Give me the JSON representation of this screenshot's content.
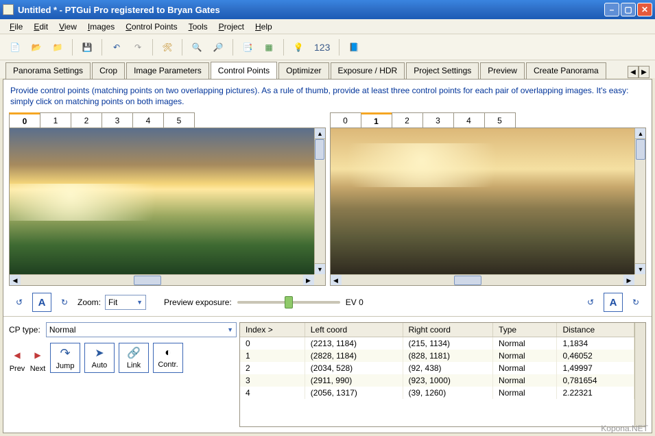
{
  "window": {
    "title": "Untitled * - PTGui Pro registered to Bryan Gates"
  },
  "menu": {
    "file": "File",
    "edit": "Edit",
    "view": "View",
    "images": "Images",
    "cpoints": "Control Points",
    "tools": "Tools",
    "project": "Project",
    "help": "Help"
  },
  "toolbar": {
    "numeric": "123"
  },
  "tabs": {
    "items": [
      "Panorama Settings",
      "Crop",
      "Image Parameters",
      "Control Points",
      "Optimizer",
      "Exposure / HDR",
      "Project Settings",
      "Preview",
      "Create Panorama"
    ],
    "active_index": 3
  },
  "instructions": "Provide control points (matching points on two overlapping pictures). As a rule of thumb, provide at least three control points for each pair of overlapping images. It's easy: simply click on matching points on both images.",
  "image_tabs": {
    "left_active": 0,
    "right_active": 1,
    "labels": [
      "0",
      "1",
      "2",
      "3",
      "4",
      "5"
    ]
  },
  "controls": {
    "zoom_label": "Zoom:",
    "zoom_value": "Fit",
    "preview_exposure_label": "Preview exposure:",
    "ev_label": "EV 0",
    "a_label": "A"
  },
  "cp": {
    "type_label": "CP type:",
    "type_value": "Normal",
    "prev": "Prev",
    "next": "Next",
    "jump": "Jump",
    "auto": "Auto",
    "link": "Link",
    "contr": "Contr."
  },
  "table": {
    "headers": [
      "Index >",
      "Left coord",
      "Right coord",
      "Type",
      "Distance"
    ],
    "rows": [
      {
        "idx": "0",
        "left": "(2213, 1184)",
        "right": "(215, 1134)",
        "type": "Normal",
        "dist": "1,1834"
      },
      {
        "idx": "1",
        "left": "(2828, 1184)",
        "right": "(828, 1181)",
        "type": "Normal",
        "dist": "0,46052"
      },
      {
        "idx": "2",
        "left": "(2034, 528)",
        "right": "(92, 438)",
        "type": "Normal",
        "dist": "1,49997"
      },
      {
        "idx": "3",
        "left": "(2911, 990)",
        "right": "(923, 1000)",
        "type": "Normal",
        "dist": "0,781654"
      },
      {
        "idx": "4",
        "left": "(2056, 1317)",
        "right": "(39, 1260)",
        "type": "Normal",
        "dist": "2.22321"
      }
    ]
  },
  "watermark": "Kopona.NET"
}
